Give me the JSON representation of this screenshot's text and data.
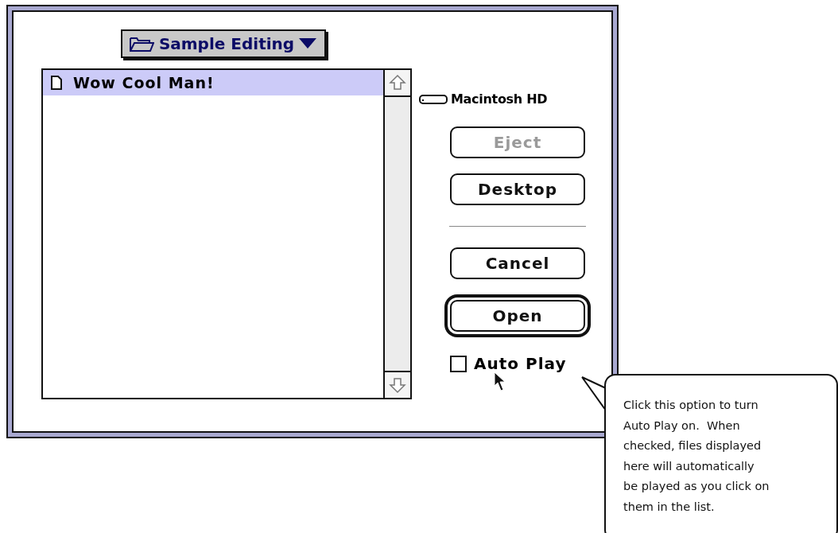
{
  "popup": {
    "label": "Sample Editing"
  },
  "files": [
    {
      "name": "Wow Cool Man!",
      "selected": true
    }
  ],
  "volume": {
    "name": "Macintosh HD"
  },
  "buttons_top": [
    {
      "label": "Eject",
      "disabled": true,
      "default": false
    },
    {
      "label": "Desktop",
      "disabled": false,
      "default": false
    }
  ],
  "buttons_bottom": [
    {
      "label": "Cancel",
      "disabled": false,
      "default": false
    },
    {
      "label": "Open",
      "disabled": false,
      "default": true
    }
  ],
  "checkbox": {
    "label": "Auto Play",
    "checked": false
  },
  "balloon": {
    "text": "Click this option to turn\nAuto Play on.  When\nchecked, files displayed\nhere will automatically\nbe played as you click on\nthem in the list."
  }
}
